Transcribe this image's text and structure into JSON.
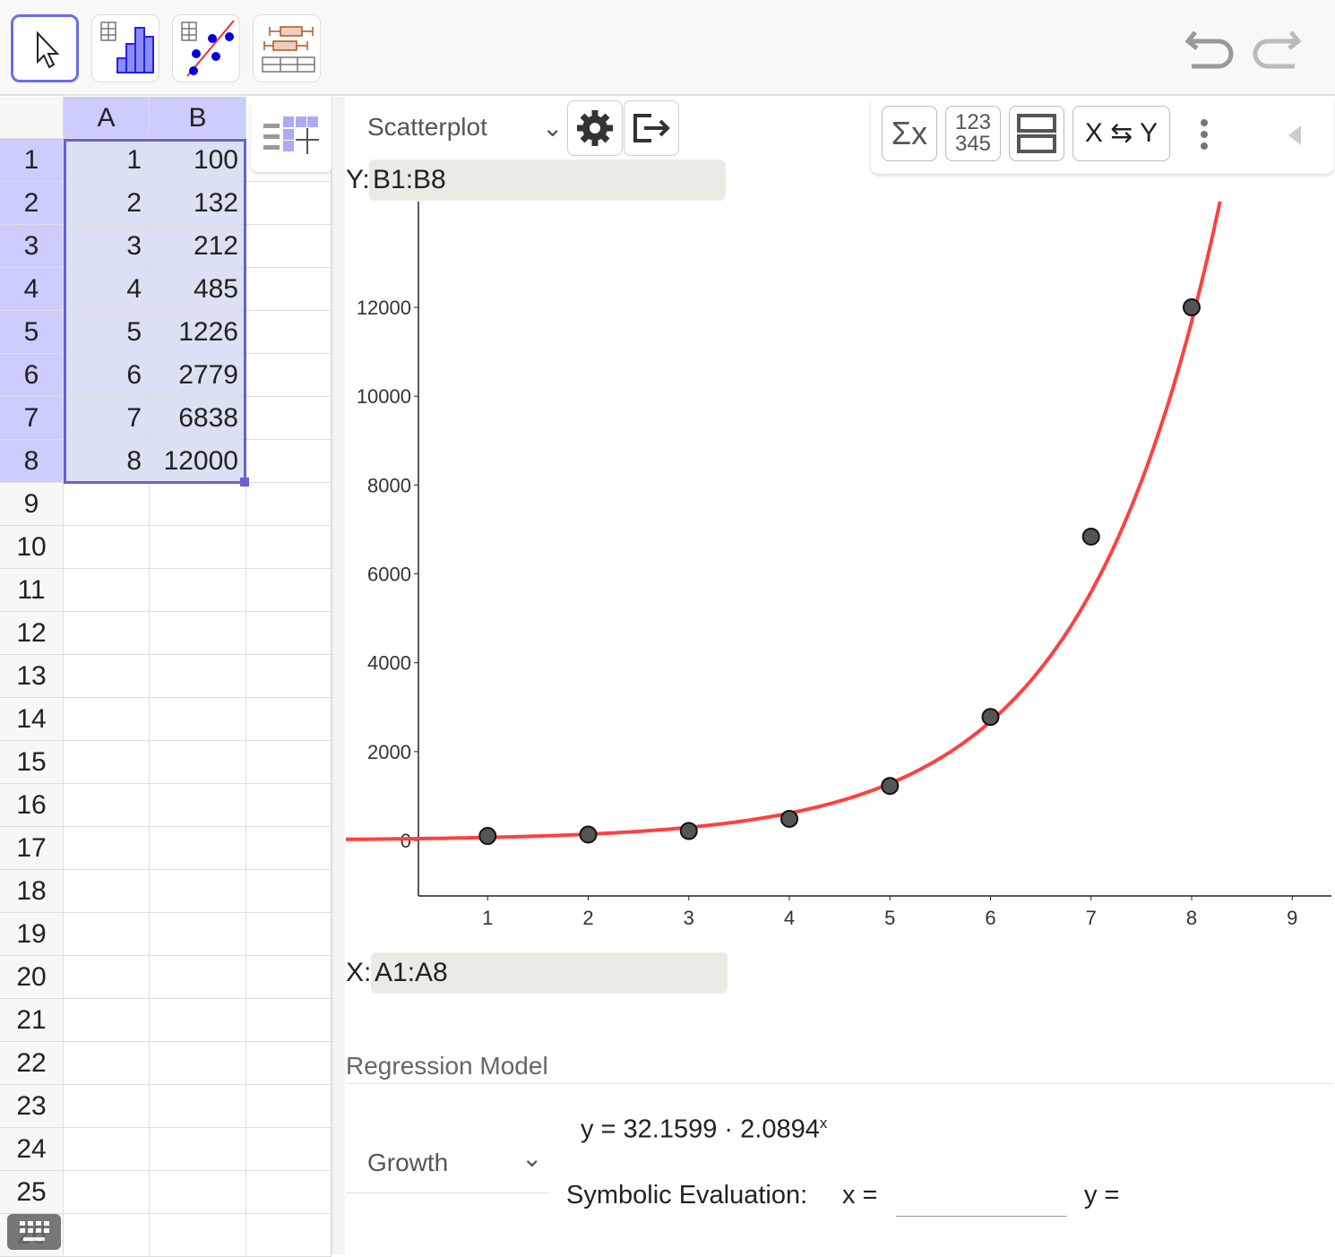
{
  "toolbar": {
    "tools": [
      "move-tool",
      "one-variable-analysis",
      "two-variable-regression",
      "multi-variable-analysis"
    ]
  },
  "spreadsheet": {
    "columns": [
      "A",
      "B"
    ],
    "rows": [
      "1",
      "2",
      "3",
      "4",
      "5",
      "6",
      "7",
      "8",
      "9",
      "10",
      "11",
      "12",
      "13",
      "14",
      "15",
      "16",
      "17",
      "18",
      "19",
      "20",
      "21",
      "22",
      "23",
      "24",
      "25",
      "26"
    ],
    "A": [
      "1",
      "2",
      "3",
      "4",
      "5",
      "6",
      "7",
      "8"
    ],
    "B": [
      "100",
      "132",
      "212",
      "485",
      "1226",
      "2779",
      "6838",
      "12000"
    ]
  },
  "plot": {
    "type_label": "Scatterplot",
    "y_label": "Y:",
    "y_range": "B1:B8",
    "x_label": "X:",
    "x_range": "A1:A8",
    "tools": {
      "stats": "Σx",
      "data": "123\n345",
      "swap": "X ⇆ Y"
    }
  },
  "chart_data": {
    "type": "scatter",
    "x": [
      1,
      2,
      3,
      4,
      5,
      6,
      7,
      8
    ],
    "y": [
      100,
      132,
      212,
      485,
      1226,
      2779,
      6838,
      12000
    ],
    "xlim": [
      -0.41,
      9.39
    ],
    "ylim": [
      -1250,
      14380
    ],
    "xticks": [
      "1",
      "2",
      "3",
      "4",
      "5",
      "6",
      "7",
      "8",
      "9"
    ],
    "yticks": [
      "0",
      "2000",
      "4000",
      "6000",
      "8000",
      "10000",
      "12000"
    ],
    "fit": {
      "a": 32.1599,
      "b": 2.0894,
      "color": "#ff4040"
    },
    "point_color": "#555555"
  },
  "regression": {
    "heading": "Regression Model",
    "model": "Growth",
    "equation": "y = 32.1599 · 2.0894",
    "exponent": "x",
    "symbolic_label": "Symbolic Evaluation:",
    "x_eq": "x =",
    "y_eq": "y =",
    "x_input": ""
  }
}
